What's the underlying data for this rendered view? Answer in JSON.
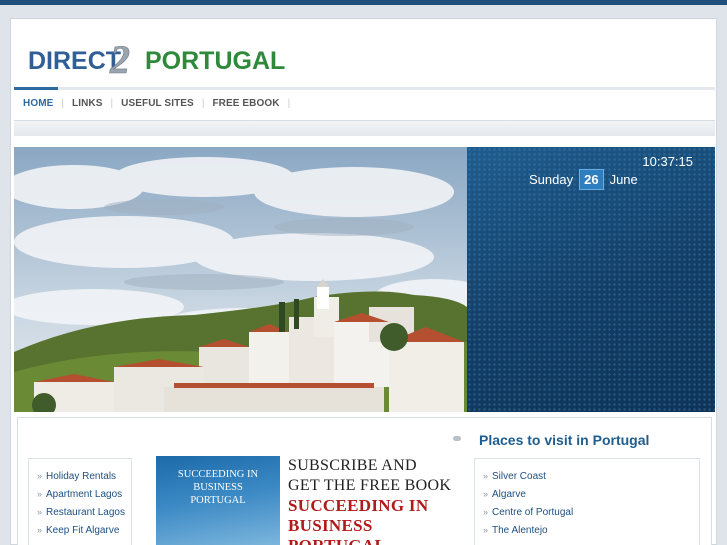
{
  "logo": {
    "part1": "DIRECT",
    "part2": "2",
    "part3": "PORTUGAL"
  },
  "nav": {
    "items": [
      "HOME",
      "LINKS",
      "USEFUL SITES",
      "FREE EBOOK"
    ],
    "active": "HOME"
  },
  "clock": {
    "time": "10:37:15",
    "weekday": "Sunday",
    "day": "26",
    "month": "June"
  },
  "places": {
    "title": "Places to visit in Portugal",
    "items": [
      "Silver Coast",
      "Algarve",
      "Centre of Portugal",
      "The Alentejo"
    ]
  },
  "sidebar_links": [
    "Holiday Rentals",
    "Apartment Lagos",
    "Restaurant Lagos",
    "Keep Fit Algarve"
  ],
  "promo": {
    "book_lines": [
      "SUCCEEDING IN",
      "BUSINESS",
      "PORTUGAL"
    ],
    "line1": "SUBSCRIBE AND",
    "line2": "GET THE FREE BOOK",
    "line3": "SUCCEEDING IN",
    "line4": "BUSINESS PORTUGAL"
  },
  "colors": {
    "accent": "#2d6ba1",
    "clock_bg": "#123e66",
    "promo_red": "#b01a1a"
  }
}
